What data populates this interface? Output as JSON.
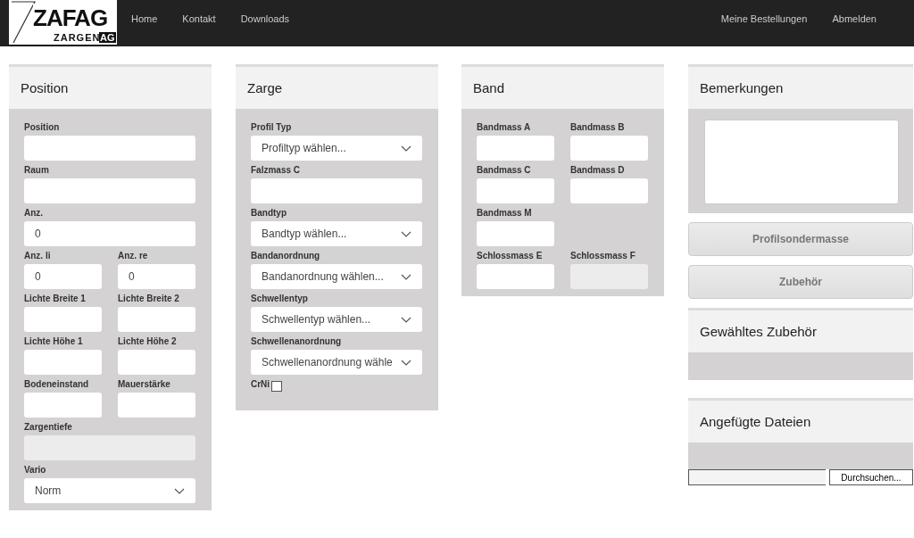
{
  "nav": {
    "logo": {
      "main": "ZAFAG",
      "sub": "ZARGEN",
      "badge": "AG"
    },
    "links": [
      "Home",
      "Kontakt",
      "Downloads"
    ],
    "right_links": [
      "Meine Bestellungen",
      "Abmelden"
    ]
  },
  "panels": [
    {
      "title": "Position",
      "rows": [
        [
          {
            "label": "Position",
            "kind": "text"
          }
        ],
        [
          {
            "label": "Raum",
            "kind": "text"
          }
        ],
        [
          {
            "label": "Anz.",
            "kind": "text",
            "value": "0"
          }
        ],
        [
          {
            "label": "Anz. li",
            "kind": "text",
            "value": "0"
          },
          {
            "label": "Anz. re",
            "kind": "text",
            "value": "0"
          }
        ],
        [
          {
            "label": "Lichte Breite 1",
            "kind": "text"
          },
          {
            "label": "Lichte Breite 2",
            "kind": "text"
          }
        ],
        [
          {
            "label": "Lichte Höhe 1",
            "kind": "text"
          },
          {
            "label": "Lichte Höhe 2",
            "kind": "text"
          }
        ],
        [
          {
            "label": "Bodeneinstand",
            "kind": "text"
          },
          {
            "label": "Mauerstärke",
            "kind": "text"
          }
        ],
        [
          {
            "label": "Zargentiefe",
            "kind": "disabled"
          }
        ],
        [
          {
            "label": "Vario",
            "kind": "select",
            "value": "Norm"
          }
        ]
      ]
    },
    {
      "title": "Zarge",
      "rows": [
        [
          {
            "label": "Profil Typ",
            "kind": "select",
            "value": "Profiltyp wählen..."
          }
        ],
        [
          {
            "label": "Falzmass C",
            "kind": "text"
          }
        ],
        [
          {
            "label": "Bandtyp",
            "kind": "select",
            "value": "Bandtyp wählen..."
          }
        ],
        [
          {
            "label": "Bandanordnung",
            "kind": "select",
            "value": "Bandanordnung wählen..."
          }
        ],
        [
          {
            "label": "Schwellentyp",
            "kind": "select",
            "value": "Schwellentyp wählen..."
          }
        ],
        [
          {
            "label": "Schwellenanordnung",
            "kind": "select",
            "value": "Schwellenanordnung wähle"
          }
        ],
        [
          {
            "label": "CrNi",
            "kind": "checkbox",
            "checked": false
          }
        ]
      ]
    },
    {
      "title": "Band",
      "rows": [
        [
          {
            "label": "Bandmass A",
            "kind": "text"
          },
          {
            "label": "Bandmass B",
            "kind": "text"
          }
        ],
        [
          {
            "label": "Bandmass C",
            "kind": "text"
          },
          {
            "label": "Bandmass D",
            "kind": "text"
          }
        ],
        [
          {
            "label": "Bandmass M",
            "kind": "text"
          }
        ],
        [
          {
            "label": "Schlossmass E",
            "kind": "text"
          },
          {
            "label": "Schlossmass F",
            "kind": "disabled"
          }
        ]
      ]
    }
  ],
  "remarks": {
    "title": "Bemerkungen"
  },
  "buttons": [
    "Profilsondermasse",
    "Zubehör"
  ],
  "selected_accessories": {
    "title": "Gewähltes Zubehör"
  },
  "attachments": {
    "title": "Angefügte Dateien",
    "browse_button": "Durchsuchen..."
  }
}
